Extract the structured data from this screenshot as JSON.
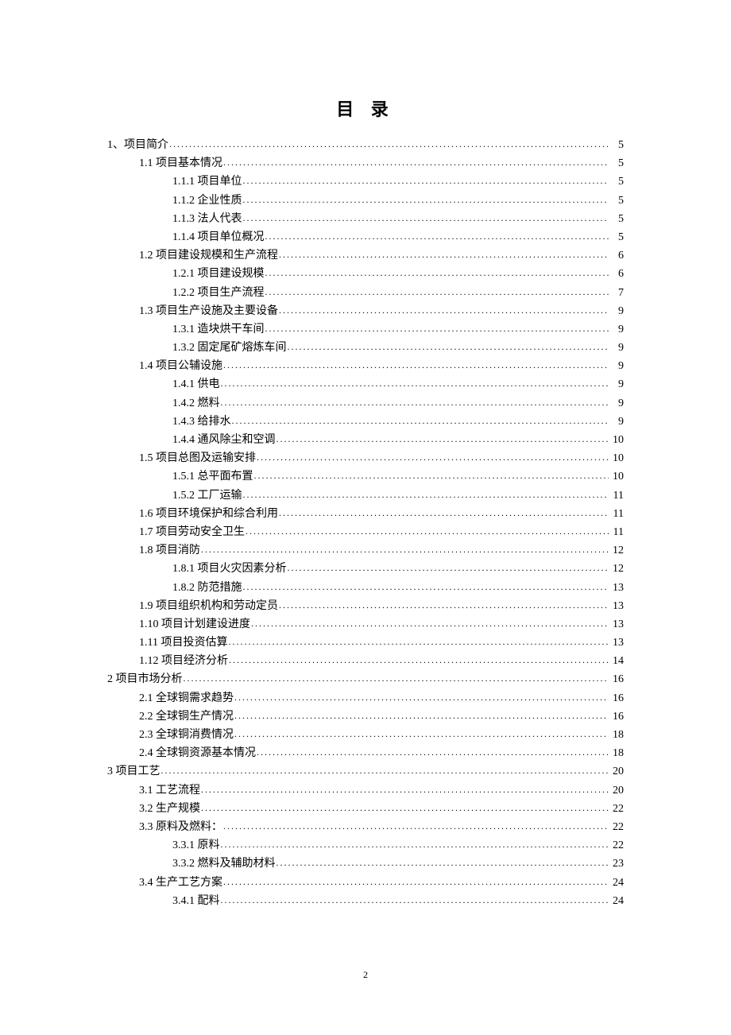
{
  "title": "目 录",
  "page_number": "2",
  "toc": [
    {
      "level": 0,
      "label": "1、项目简介",
      "page": "5"
    },
    {
      "level": 1,
      "label": "1.1 项目基本情况",
      "page": "5"
    },
    {
      "level": 2,
      "label": "1.1.1 项目单位",
      "page": "5"
    },
    {
      "level": 2,
      "label": "1.1.2 企业性质",
      "page": "5"
    },
    {
      "level": 2,
      "label": "1.1.3 法人代表",
      "page": "5"
    },
    {
      "level": 2,
      "label": "1.1.4 项目单位概况",
      "page": "5"
    },
    {
      "level": 1,
      "label": "1.2  项目建设规模和生产流程",
      "page": "6"
    },
    {
      "level": 2,
      "label": "1.2.1  项目建设规模",
      "page": "6"
    },
    {
      "level": 2,
      "label": "1.2.2  项目生产流程",
      "page": "7"
    },
    {
      "level": 1,
      "label": "1.3 项目生产设施及主要设备",
      "page": "9"
    },
    {
      "level": 2,
      "label": "1.3.1 造块烘干车间",
      "page": "9"
    },
    {
      "level": 2,
      "label": "1.3.2 固定尾矿熔炼车间",
      "page": "9"
    },
    {
      "level": 1,
      "label": "1.4 项目公辅设施",
      "page": "9"
    },
    {
      "level": 2,
      "label": "1.4.1 供电",
      "page": "9"
    },
    {
      "level": 2,
      "label": "1.4.2 燃料",
      "page": "9"
    },
    {
      "level": 2,
      "label": "1.4.3 给排水",
      "page": "9"
    },
    {
      "level": 2,
      "label": "1.4.4 通风除尘和空调",
      "page": "10"
    },
    {
      "level": 1,
      "label": "1.5 项目总图及运输安排",
      "page": "10"
    },
    {
      "level": 2,
      "label": "1.5.1  总平面布置",
      "page": "10"
    },
    {
      "level": 2,
      "label": "1.5.2  工厂运输",
      "page": "11"
    },
    {
      "level": 1,
      "label": "1.6 项目环境保护和综合利用",
      "page": "11"
    },
    {
      "level": 1,
      "label": "1.7 项目劳动安全卫生",
      "page": "11"
    },
    {
      "level": 1,
      "label": "1.8 项目消防",
      "page": "12"
    },
    {
      "level": 2,
      "label": "1.8.1  项目火灾因素分析",
      "page": "12"
    },
    {
      "level": 2,
      "label": "1.8.2  防范措施",
      "page": "13"
    },
    {
      "level": 1,
      "label": "1.9  项目组织机构和劳动定员",
      "page": "13"
    },
    {
      "level": 1,
      "label": "1.10  项目计划建设进度",
      "page": "13"
    },
    {
      "level": 1,
      "label": "1.11  项目投资估算",
      "page": "13"
    },
    {
      "level": 1,
      "label": "1.12 项目经济分析",
      "page": "14"
    },
    {
      "level": 0,
      "label": "2  项目市场分析",
      "page": "16"
    },
    {
      "level": 1,
      "label": "2.1 全球铜需求趋势",
      "page": "16"
    },
    {
      "level": 1,
      "label": "2.2  全球铜生产情况",
      "page": "16"
    },
    {
      "level": 1,
      "label": "2.3 全球铜消费情况",
      "page": "18"
    },
    {
      "level": 1,
      "label": "2.4 全球铜资源基本情况",
      "page": "18"
    },
    {
      "level": 0,
      "label": "3  项目工艺",
      "page": "20"
    },
    {
      "level": 1,
      "label": "3.1  工艺流程",
      "page": "20"
    },
    {
      "level": 1,
      "label": "3.2  生产规模",
      "page": "22"
    },
    {
      "level": 1,
      "label": "3.3  原料及燃料：",
      "page": "22"
    },
    {
      "level": 2,
      "label": "3.3.1  原料",
      "page": "22"
    },
    {
      "level": 2,
      "label": "3.3.2  燃料及辅助材料",
      "page": "23"
    },
    {
      "level": 1,
      "label": "3.4  生产工艺方案",
      "page": "24"
    },
    {
      "level": 2,
      "label": "3.4.1  配料",
      "page": "24"
    }
  ]
}
